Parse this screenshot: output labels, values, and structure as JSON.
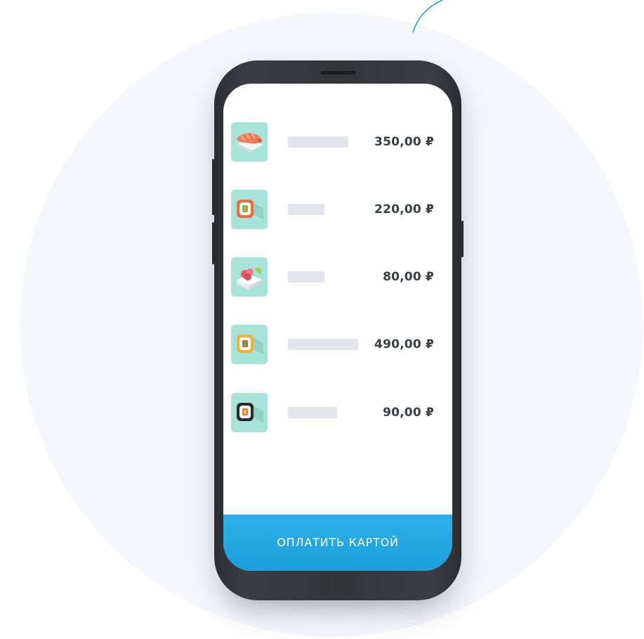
{
  "items": [
    {
      "price": "350,00 ₽",
      "icon": "nigiri-sushi-icon"
    },
    {
      "price": "220,00 ₽",
      "icon": "salmon-roll-icon"
    },
    {
      "price": "80,00 ₽",
      "icon": "salad-box-icon"
    },
    {
      "price": "490,00 ₽",
      "icon": "yellow-roll-icon"
    },
    {
      "price": "90,00 ₽",
      "icon": "maki-roll-icon"
    }
  ],
  "pay_button": {
    "label": "ОПЛАТИТЬ КАРТОЙ"
  },
  "colors": {
    "accent": "#1fa3df",
    "thumb_background": "#a7e3d8",
    "placeholder": "#e2e6ec",
    "price_text": "#3a3d42",
    "background_circle": "#f5f7fc"
  }
}
